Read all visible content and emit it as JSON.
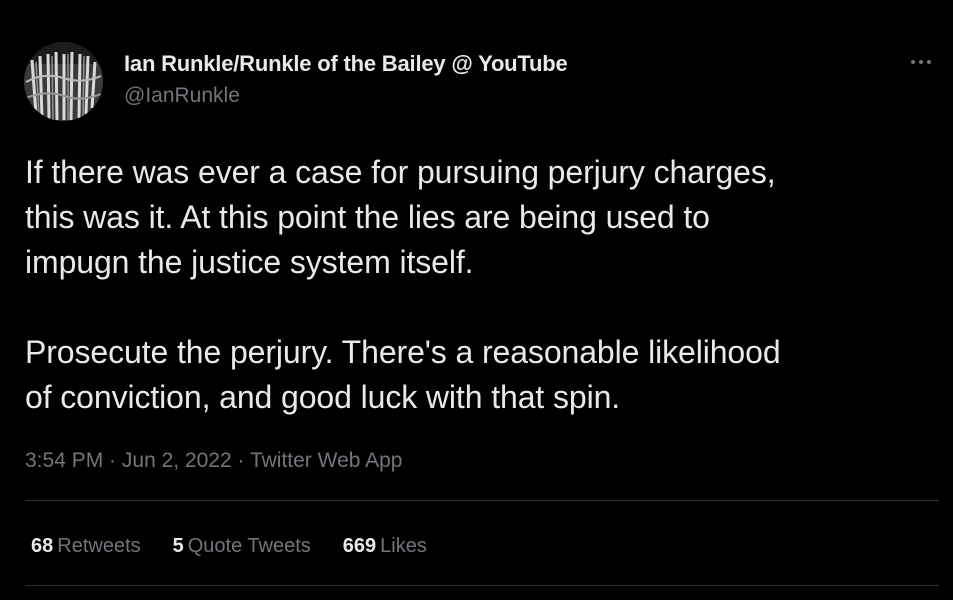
{
  "colors": {
    "background": "#000000",
    "primary_text": "#e7e9ea",
    "secondary_text": "#71767b",
    "divider": "#2f3336"
  },
  "author": {
    "display_name": "Ian Runkle/Runkle of the Bailey @ YouTube",
    "handle": "@IanRunkle",
    "avatar_icon": "profile-photo"
  },
  "menu": {
    "icon": "more-horizontal-icon"
  },
  "tweet": {
    "paragraphs": [
      "If there was ever a case for pursuing perjury charges,\nthis was it. At this point the lies are being used to\nimpugn the justice system itself.",
      "Prosecute the perjury. There's a reasonable likelihood\nof conviction, and good luck with that spin."
    ]
  },
  "meta": {
    "time": "3:54 PM",
    "separator": " · ",
    "date": "Jun 2, 2022",
    "source": "Twitter Web App"
  },
  "stats": {
    "retweets": {
      "count": "68",
      "label": "Retweets"
    },
    "quote_tweets": {
      "count": "5",
      "label": "Quote Tweets"
    },
    "likes": {
      "count": "669",
      "label": "Likes"
    }
  }
}
